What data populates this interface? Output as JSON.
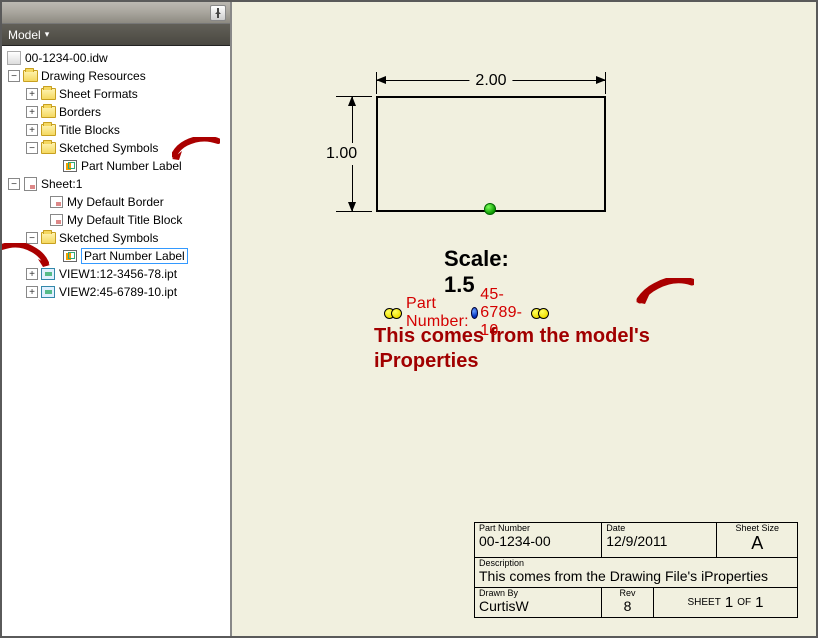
{
  "panel": {
    "browser_title": "",
    "header": "Model",
    "dropdown_indicator": "▾"
  },
  "tree": {
    "root": "00-1234-00.idw",
    "drawing_resources": "Drawing Resources",
    "sheet_formats": "Sheet Formats",
    "borders": "Borders",
    "title_blocks": "Title Blocks",
    "sketched_symbols": "Sketched Symbols",
    "part_number_label": "Part Number Label",
    "sheet1": "Sheet:1",
    "my_default_border": "My Default Border",
    "my_default_title_block": "My Default Title Block",
    "sketched_symbols2": "Sketched Symbols",
    "part_number_label2": "Part Number Label",
    "view1": "VIEW1:12-3456-78.ipt",
    "view2": "VIEW2:45-6789-10.ipt"
  },
  "drawing": {
    "dim_width": "2.00",
    "dim_height": "1.00",
    "scale_label": "Scale: 1.5",
    "part_number_prefix": "Part Number:",
    "part_number_value": "45-6789-10",
    "annotation": "This comes from the model's iProperties"
  },
  "title_block": {
    "part_number_lbl": "Part Number",
    "part_number_val": "00-1234-00",
    "date_lbl": "Date",
    "date_val": "12/9/2011",
    "sheet_size_lbl": "Sheet Size",
    "sheet_size_val": "A",
    "description_lbl": "Description",
    "description_val": "This comes from the Drawing File's iProperties",
    "drawn_by_lbl": "Drawn By",
    "drawn_by_val": "CurtisW",
    "rev_lbl": "Rev",
    "rev_val": "8",
    "sheet_of_prefix": "SHEET",
    "sheet_of_mid": "OF",
    "sheet_current": "1",
    "sheet_total": "1"
  }
}
